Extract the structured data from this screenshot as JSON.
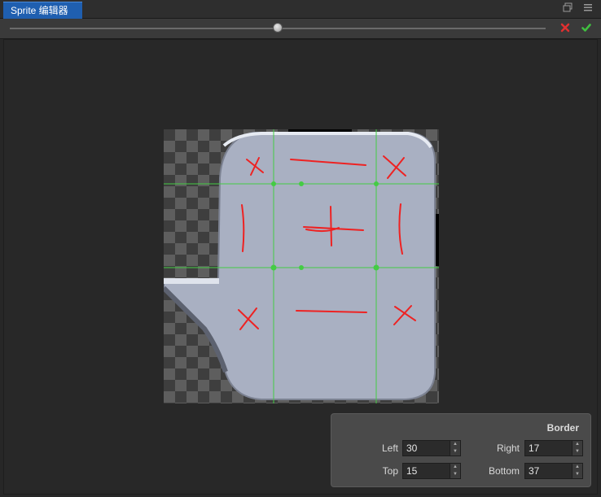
{
  "tab": {
    "title": "Sprite 编辑器"
  },
  "window": {
    "restore_icon": "restore-icon",
    "menu_icon": "menu-icon"
  },
  "toolbar": {
    "zoom_fraction": 0.5,
    "cancel_icon": "close-icon",
    "confirm_icon": "check-icon",
    "cancel_color": "#e03030",
    "confirm_color": "#40c040"
  },
  "border": {
    "title": "Border",
    "left_label": "Left",
    "left_value": "30",
    "right_label": "Right",
    "right_value": "17",
    "top_label": "Top",
    "top_value": "15",
    "bottom_label": "Bottom",
    "bottom_value": "37"
  },
  "colors": {
    "accent": "#1f5fb0",
    "guide": "#44cc44",
    "handle": "#44cc44",
    "annotation": "#ee2222",
    "sprite_fill": "#a9b0c2"
  }
}
